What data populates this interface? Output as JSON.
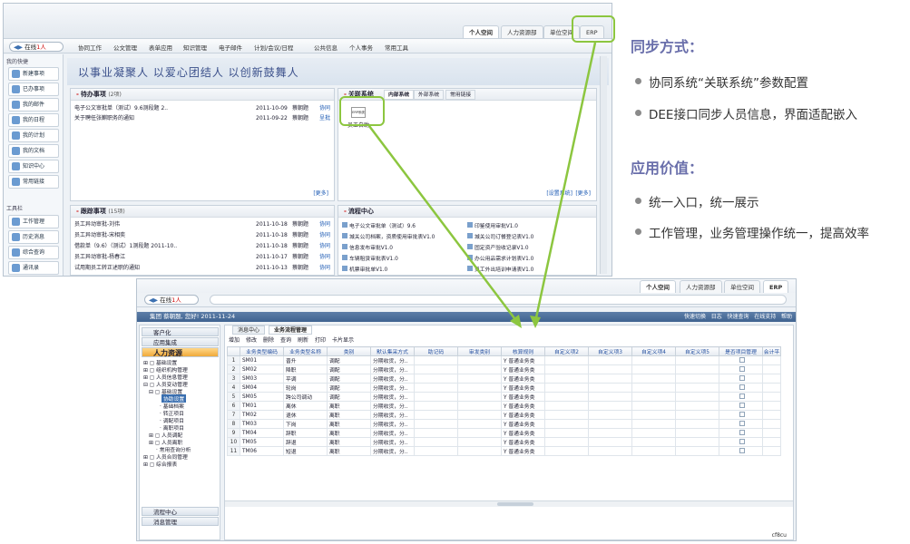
{
  "shot1": {
    "top_tabs": [
      "个人空间",
      "人力资源部",
      "单位空间",
      "ERP"
    ],
    "online_label": "在线",
    "online_count": "1人",
    "menu": [
      "协同工作",
      "公文管理",
      "表单应用",
      "知识管理",
      "电子邮件",
      "计划/会议/日程",
      "公共信息",
      "个人事务",
      "常用工具"
    ],
    "left_header": "我的快捷",
    "left_items": [
      "新建事项",
      "已办事项",
      "我的邮件",
      "我的日程",
      "我的计划",
      "我的文档",
      "知识中心",
      "常用链接"
    ],
    "tools_header": "工具栏",
    "tool_items": [
      "工作管理",
      "历史消息",
      "综合查询",
      "通讯录"
    ],
    "banner": "以事业凝聚人  以爱心团结人  以创新鼓舞人",
    "todo": {
      "title": "待办事项",
      "count": "(2项)",
      "rows": [
        {
          "text": "电子公文审批单（测试）9.6测段题 2..",
          "date": "2011-10-09",
          "name": "蔡朝题",
          "action": "协同"
        },
        {
          "text": "关于聘任张麒职务的通知",
          "date": "2011-09-22",
          "name": "蔡朝题",
          "action": "呈批"
        }
      ],
      "more": "[更多]"
    },
    "related": {
      "title": "关联系统",
      "tabs": [
        "内部系统",
        "外部系统",
        "常用链接"
      ],
      "app_icon_text": "ERP系统",
      "app_label": "员工自助",
      "more1": "[设置系统]",
      "more2": "[更多]"
    },
    "tracking": {
      "title": "跟踪事项",
      "count": "(15项)",
      "rows": [
        {
          "text": "员工异动审批-刘伟",
          "date": "2011-10-18",
          "name": "蔡朝题",
          "action": "协同"
        },
        {
          "text": "员工异动审批-宋相奕",
          "date": "2011-10-18",
          "name": "蔡朝题",
          "action": "协同"
        },
        {
          "text": "借款单（9.6）（测试）1测段题 2011-10..",
          "date": "2011-10-18",
          "name": "蔡朝题",
          "action": "协同"
        },
        {
          "text": "员工异动审批-杨春江",
          "date": "2011-10-17",
          "name": "蔡朝题",
          "action": "协同"
        },
        {
          "text": "试用期员工转正述职的通知",
          "date": "2011-10-13",
          "name": "蔡朝题",
          "action": "协同"
        }
      ]
    },
    "flow": {
      "title": "流程中心",
      "left": [
        "电子公文审批单（测试）9.6",
        "城关公司档案，资质使用审批表V1.0",
        "信息发布审批V1.0",
        "车辆租赁审批表V1.0",
        "机票审批单V1.0"
      ],
      "right": [
        "印鉴使用审批V1.0",
        "城关公司订餐登记表V1.0",
        "固定资产验收记录V1.0",
        "办公用品需求计划表V1.0",
        "员工外出培训申请表V1.0"
      ]
    }
  },
  "shot2": {
    "top_tabs": [
      "个人空间",
      "人力资源部",
      "单位空间",
      "ERP"
    ],
    "online_label": "在线",
    "online_count": "1人",
    "welcome": "集团 蔡朝题, 您好! 2011-11-24",
    "right_links": [
      "快速切换",
      "日志",
      "快速查询",
      "在线支持",
      "帮助"
    ],
    "nav_top": [
      "客户化",
      "应用集成"
    ],
    "nav_hr": "人力资源",
    "tree": [
      "基础设置",
      "组织机构管理",
      "人员信息管理",
      "人员变动管理",
      "基础设置",
      "协助设置",
      "基础档案",
      "转正项目",
      "调配项目",
      "离职项目",
      "人员调配",
      "人员离职",
      "常用查询分析",
      "人员合同管理",
      "综合报表"
    ],
    "nav_bottom": [
      "流程中心",
      "消息管理"
    ],
    "content_tabs": [
      "消息中心",
      "业务流程管理"
    ],
    "toolbar": [
      "增加",
      "修改",
      "删除",
      "查询",
      "刷新",
      "打印",
      "卡片显示"
    ],
    "columns": [
      "业务类型编码",
      "业务类型名称",
      "类别",
      "默认集采方式",
      "助记码",
      "审发类别",
      "核算规则",
      "自定义项2",
      "自定义项3",
      "自定义项4",
      "自定义项5",
      "是否项目管理",
      "会计平"
    ],
    "rows": [
      [
        "1",
        "SM01",
        "晋升",
        "调配",
        "分期收货，分..",
        "",
        "",
        "Y 普通业务类",
        "",
        "",
        "",
        "",
        ""
      ],
      [
        "2",
        "SM02",
        "降职",
        "调配",
        "分期收货，分..",
        "",
        "",
        "Y 普通业务类",
        "",
        "",
        "",
        "",
        ""
      ],
      [
        "3",
        "SM03",
        "平调",
        "调配",
        "分期收货，分..",
        "",
        "",
        "Y 普通业务类",
        "",
        "",
        "",
        "",
        ""
      ],
      [
        "4",
        "SM04",
        "轮岗",
        "调配",
        "分期收货，分..",
        "",
        "",
        "Y 普通业务类",
        "",
        "",
        "",
        "",
        ""
      ],
      [
        "5",
        "SM05",
        "跨公司调动",
        "调配",
        "分期收货，分..",
        "",
        "",
        "Y 普通业务类",
        "",
        "",
        "",
        "",
        ""
      ],
      [
        "6",
        "TM01",
        "离休",
        "离职",
        "分期收货，分..",
        "",
        "",
        "Y 普通业务类",
        "",
        "",
        "",
        "",
        ""
      ],
      [
        "7",
        "TM02",
        "退休",
        "离职",
        "分期收货，分..",
        "",
        "",
        "Y 普通业务类",
        "",
        "",
        "",
        "",
        ""
      ],
      [
        "8",
        "TM03",
        "下岗",
        "离职",
        "分期收货，分..",
        "",
        "",
        "Y 普通业务类",
        "",
        "",
        "",
        "",
        ""
      ],
      [
        "9",
        "TM04",
        "辞职",
        "离职",
        "分期收货，分..",
        "",
        "",
        "Y 普通业务类",
        "",
        "",
        "",
        "",
        ""
      ],
      [
        "10",
        "TM05",
        "辞退",
        "离职",
        "分期收货，分..",
        "",
        "",
        "Y 普通业务类",
        "",
        "",
        "",
        "",
        ""
      ],
      [
        "11",
        "TM06",
        "短退",
        "离职",
        "分期收货，分..",
        "",
        "",
        "Y 普通业务类",
        "",
        "",
        "",
        "",
        ""
      ]
    ],
    "footer_code": "cf8cu"
  },
  "right": {
    "sync_title": "同步方式：",
    "sync_bullets": [
      "协同系统“关联系统”参数配置",
      "DEE接口同步人员信息，界面适配嵌入"
    ],
    "value_title": "应用价值：",
    "value_bullets": [
      "统一入口，统一展示",
      "工作管理，业务管理操作统一，提高效率"
    ]
  },
  "colors": {
    "callout": "#8cc63f",
    "heading": "#6a6fab",
    "hr_nav": "#f0a93a",
    "brand_bar": "#3f6390"
  }
}
